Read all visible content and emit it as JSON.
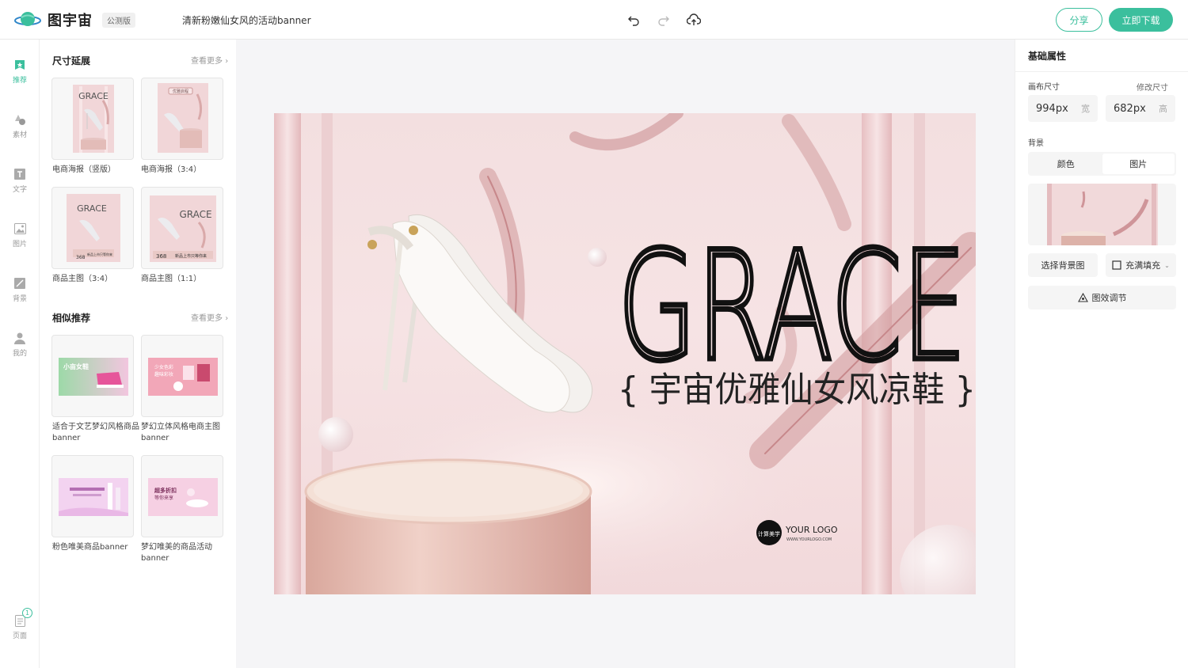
{
  "header": {
    "app_name": "图宇宙",
    "beta_label": "公测版",
    "doc_title": "清新粉嫩仙女风的活动banner",
    "share_label": "分享",
    "download_label": "立即下载"
  },
  "rail": {
    "items": [
      {
        "label": "推荐"
      },
      {
        "label": "素材"
      },
      {
        "label": "文字"
      },
      {
        "label": "图片"
      },
      {
        "label": "背景"
      },
      {
        "label": "我的"
      }
    ],
    "page_label": "页面",
    "page_count": "1"
  },
  "panel": {
    "size_section": {
      "title": "尺寸延展",
      "more": "查看更多",
      "cards": [
        {
          "label": "电商海报（竖版）"
        },
        {
          "label": "电商海报（3:4）"
        },
        {
          "label": "商品主图（3:4）"
        },
        {
          "label": "商品主图（1:1）"
        }
      ]
    },
    "similar_section": {
      "title": "相似推荐",
      "more": "查看更多",
      "cards": [
        {
          "label": "适合于文艺梦幻风格商品banner"
        },
        {
          "label": "梦幻立体风格电商主图banner"
        },
        {
          "label": "粉色唯美商品banner"
        },
        {
          "label": "梦幻唯美的商品活动banner"
        }
      ]
    },
    "thumb_texts": {
      "grace": "GRACE",
      "elegant": "优雅启程",
      "price": "368",
      "launch": "新品上市只等你来",
      "small_shoes": "小亩女鞋",
      "girl_color": "少女色彩",
      "taste": "趣味彩妆",
      "super_discount": "超多折扣",
      "waiting": "等你来享"
    }
  },
  "canvas": {
    "headline": "GRACE",
    "subtitle": "{ 宇宙优雅仙女风凉鞋 }",
    "logo_mark": "计算美学",
    "logo_text": "YOUR LOGO",
    "logo_url": "WWW.YOURLOGO.COM"
  },
  "props": {
    "title": "基础属性",
    "canvas_size_label": "画布尺寸",
    "resize_label": "修改尺寸",
    "width_value": "994px",
    "width_unit": "宽",
    "height_value": "682px",
    "height_unit": "高",
    "background_label": "背景",
    "tab_color": "颜色",
    "tab_image": "图片",
    "choose_bg": "选择背景图",
    "fill_mode": "充满填充",
    "effect_adjust": "图效调节"
  },
  "colors": {
    "accent": "#3bbf9d",
    "canvas_pink": "#f3dfe0"
  }
}
